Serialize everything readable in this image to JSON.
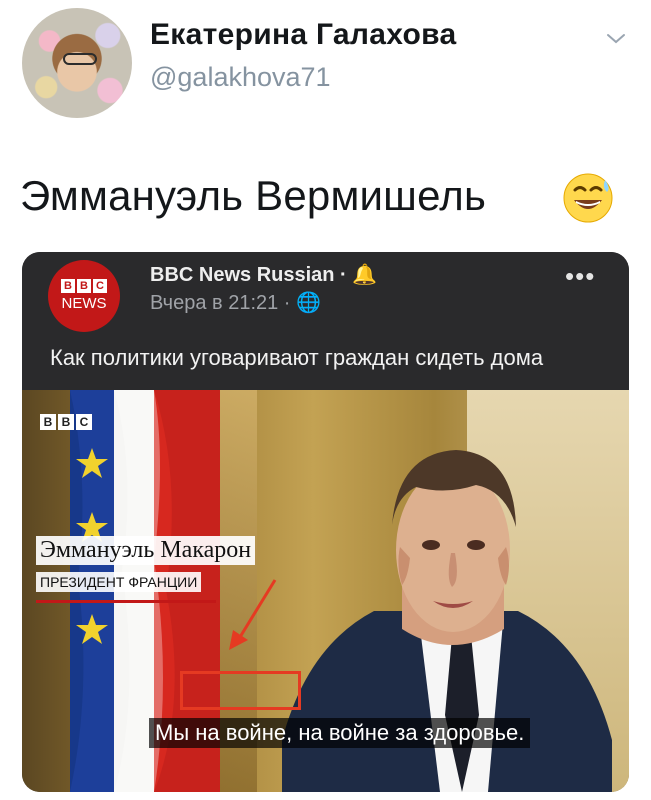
{
  "tweet": {
    "author_name": "Екатерина Галахова",
    "author_handle": "@galakhova71",
    "text": "Эммануэль Вермишель",
    "emoji": "grinning-face-with-sweat"
  },
  "embedded_post": {
    "logo_top": [
      "B",
      "B",
      "C"
    ],
    "logo_bottom": "NEWS",
    "page_name": "BBC News Russian · 🔔",
    "timestamp": "Вчера в 21:21 · 🌐",
    "more_label": "•••",
    "caption": "Как политики уговаривают граждан сидеть дома"
  },
  "video": {
    "bbc_bug": [
      "B",
      "B",
      "C"
    ],
    "name_strap": "Эммануэль Макарон",
    "title_strap": "ПРЕЗИДЕНТ ФРАНЦИИ",
    "subtitle": "Мы на войне, на войне за здоровье."
  },
  "colors": {
    "bbc_red": "#c21818",
    "annotation_red": "#e53a22",
    "handle_gray": "#8593a0",
    "dark_header": "#2a2a2c"
  }
}
